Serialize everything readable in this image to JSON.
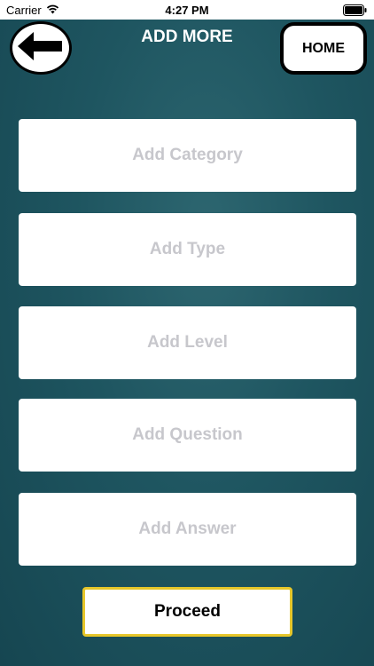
{
  "status_bar": {
    "carrier": "Carrier",
    "time": "4:27 PM",
    "wifi_icon": "wifi-icon",
    "battery_icon": "battery-icon"
  },
  "header": {
    "title": "ADD MORE",
    "back_icon": "arrow-left-icon",
    "home_label": "HOME"
  },
  "form": {
    "category": {
      "value": "",
      "placeholder": "Add Category"
    },
    "type": {
      "value": "",
      "placeholder": "Add Type"
    },
    "level": {
      "value": "",
      "placeholder": "Add Level"
    },
    "question": {
      "value": "",
      "placeholder": "Add Question"
    },
    "answer": {
      "value": "",
      "placeholder": "Add Answer"
    }
  },
  "footer": {
    "proceed_label": "Proceed"
  },
  "colors": {
    "background": "#1e5560",
    "field_background": "#ffffff",
    "placeholder": "#c7c7cc",
    "proceed_border": "#e6c62a",
    "title_text": "#ffffff"
  }
}
